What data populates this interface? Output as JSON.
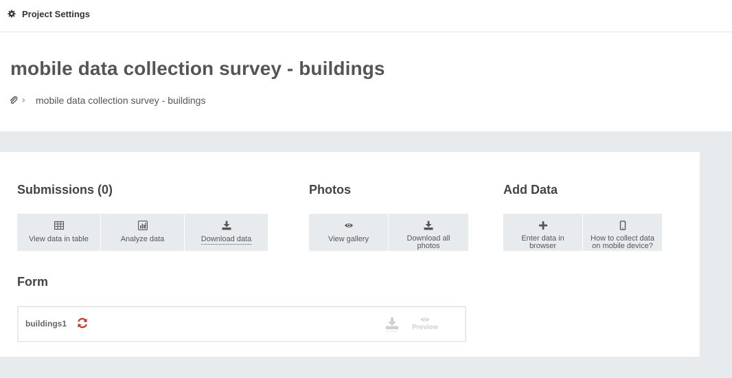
{
  "topbar": {
    "settings_label": "Project Settings"
  },
  "header": {
    "title": "mobile data collection survey - buildings",
    "breadcrumb": "mobile data collection survey - buildings"
  },
  "submissions": {
    "title": "Submissions (0)",
    "buttons": [
      {
        "label": "View data in table",
        "icon": "table-icon"
      },
      {
        "label": "Analyze data",
        "icon": "bar-chart-icon"
      },
      {
        "label": "Download data",
        "icon": "download-icon"
      }
    ]
  },
  "photos": {
    "title": "Photos",
    "buttons": [
      {
        "label": "View gallery",
        "icon": "eye-icon"
      },
      {
        "label_line1": "Download all",
        "label_line2": "photos",
        "icon": "download-icon"
      }
    ]
  },
  "add_data": {
    "title": "Add Data",
    "buttons": [
      {
        "label_line1": "Enter data in",
        "label_line2": "browser",
        "icon": "plus-icon"
      },
      {
        "label_line1": "How to collect data",
        "label_line2": "on mobile device?",
        "icon": "mobile-icon"
      }
    ]
  },
  "form": {
    "title": "Form",
    "name": "buildings1",
    "preview_label": "Preview",
    "sync_color": "#c0392b"
  },
  "colors": {
    "panel_background": "#e8ebee",
    "tile_background": "#e8ebee",
    "text": "#555555"
  }
}
